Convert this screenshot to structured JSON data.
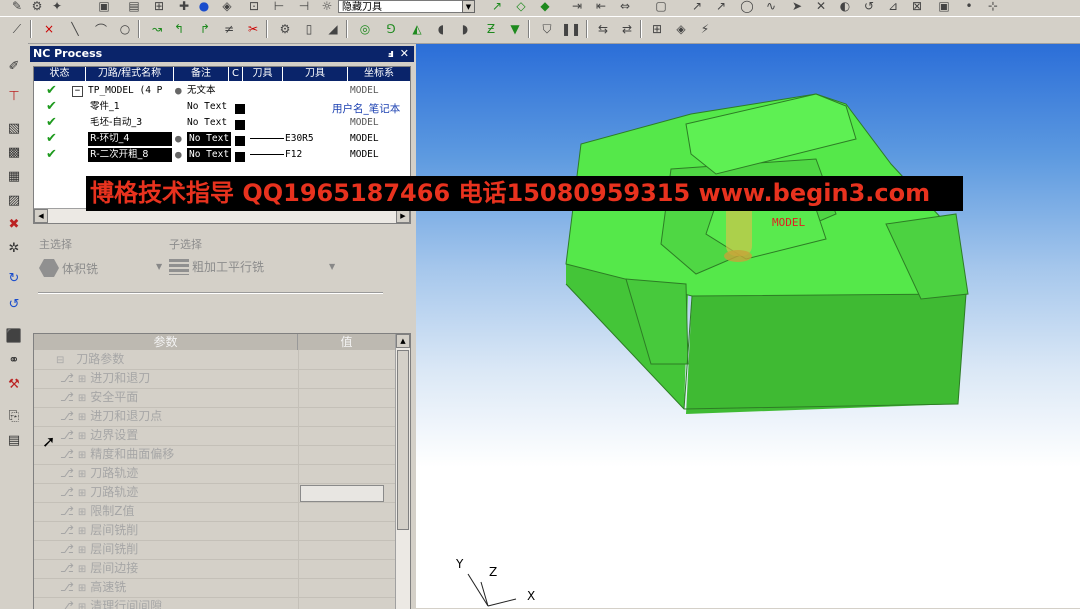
{
  "toolbar1": {
    "hidden_tool_combo": "隐藏刀具"
  },
  "panel": {
    "title": "NC Process",
    "pin_glyph": "ⅎ",
    "close_glyph": "✕",
    "tree_columns": [
      "状态",
      "刀路/程式名称",
      "备注",
      "C",
      "刀具",
      "刀具",
      "坐标系"
    ],
    "tree_rows": [
      {
        "name": "TP_MODEL (4 P",
        "note": "无文本",
        "tool": "",
        "coord": "MODEL",
        "selected": false,
        "expander": "−"
      },
      {
        "name": "零件_1",
        "note": "No Text",
        "tool": "",
        "coord": "MODEL",
        "selected": false
      },
      {
        "name": "毛坯-自动_3",
        "note": "No Text",
        "tool": "",
        "coord": "MODEL",
        "selected": false
      },
      {
        "name": "R-环切_4",
        "note": "No Text",
        "tool": "E30R5",
        "coord": "MODEL",
        "selected": true
      },
      {
        "name": "R-二次开粗_8",
        "note": "No Text",
        "tool": "F12",
        "coord": "MODEL",
        "selected": true
      }
    ],
    "tooltip": "用户名_笔记本"
  },
  "selection": {
    "main_label": "主选择",
    "main_value": "体积铣",
    "sub_label": "子选择",
    "sub_value": "粗加工平行铣"
  },
  "params": {
    "col_param": "参数",
    "col_value": "值",
    "root": "刀路参数",
    "items": [
      "进刀和退刀",
      "安全平面",
      "进刀和退刀点",
      "边界设置",
      "精度和曲面偏移",
      "刀路轨迹",
      "刀路轨迹",
      "限制Z值",
      "层间铣削",
      "层间铣削",
      "层间边接",
      "高速铣",
      "清理行间间隙"
    ]
  },
  "viewport": {
    "model_label": "MODEL",
    "axis_x": "X",
    "axis_y": "Y",
    "axis_z": "Z"
  },
  "banner": {
    "text": "博格技术指导 QQ1965187466 电话15080959315 www.begin3.com"
  },
  "colors": {
    "model_green": "#55e84a",
    "banner_red": "#e8321e",
    "title_blue": "#0a246a"
  }
}
